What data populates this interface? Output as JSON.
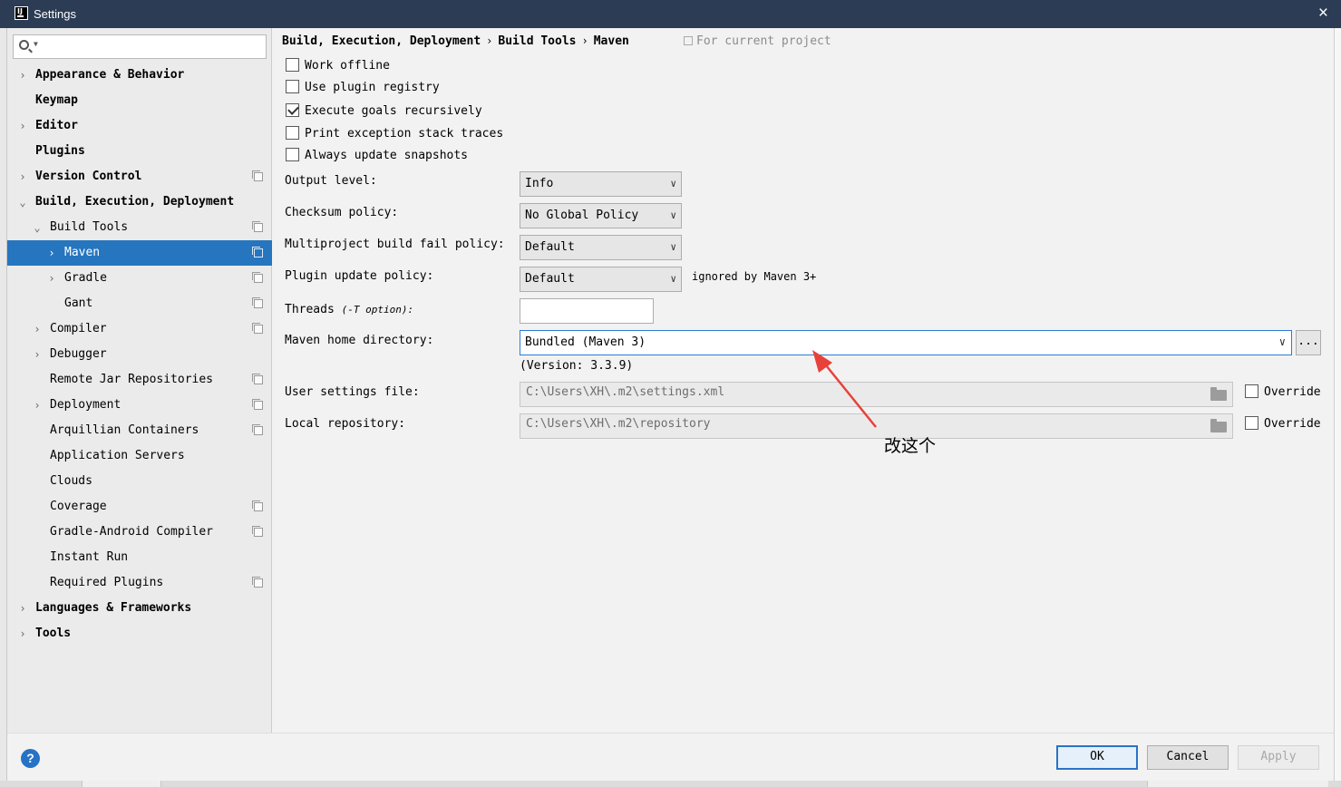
{
  "window": {
    "title": "Settings",
    "close_glyph": "×"
  },
  "sidebar": {
    "search_placeholder": "",
    "items": [
      {
        "label": "Appearance & Behavior",
        "level": 0,
        "arrow": "›",
        "bold": true,
        "proj": false
      },
      {
        "label": "Keymap",
        "level": 0,
        "arrow": "",
        "bold": true,
        "proj": false
      },
      {
        "label": "Editor",
        "level": 0,
        "arrow": "›",
        "bold": true,
        "proj": false
      },
      {
        "label": "Plugins",
        "level": 0,
        "arrow": "",
        "bold": true,
        "proj": false
      },
      {
        "label": "Version Control",
        "level": 0,
        "arrow": "›",
        "bold": true,
        "proj": true
      },
      {
        "label": "Build, Execution, Deployment",
        "level": 0,
        "arrow": "⌄",
        "bold": true,
        "proj": false
      },
      {
        "label": "Build Tools",
        "level": 1,
        "arrow": "⌄",
        "bold": false,
        "proj": true
      },
      {
        "label": "Maven",
        "level": 2,
        "arrow": "›",
        "bold": false,
        "proj": true,
        "selected": true
      },
      {
        "label": "Gradle",
        "level": 2,
        "arrow": "›",
        "bold": false,
        "proj": true
      },
      {
        "label": "Gant",
        "level": 2,
        "arrow": "",
        "bold": false,
        "proj": true
      },
      {
        "label": "Compiler",
        "level": 1,
        "arrow": "›",
        "bold": false,
        "proj": true
      },
      {
        "label": "Debugger",
        "level": 1,
        "arrow": "›",
        "bold": false,
        "proj": false
      },
      {
        "label": "Remote Jar Repositories",
        "level": 1,
        "arrow": "",
        "bold": false,
        "proj": true
      },
      {
        "label": "Deployment",
        "level": 1,
        "arrow": "›",
        "bold": false,
        "proj": true
      },
      {
        "label": "Arquillian Containers",
        "level": 1,
        "arrow": "",
        "bold": false,
        "proj": true
      },
      {
        "label": "Application Servers",
        "level": 1,
        "arrow": "",
        "bold": false,
        "proj": false
      },
      {
        "label": "Clouds",
        "level": 1,
        "arrow": "",
        "bold": false,
        "proj": false
      },
      {
        "label": "Coverage",
        "level": 1,
        "arrow": "",
        "bold": false,
        "proj": true
      },
      {
        "label": "Gradle-Android Compiler",
        "level": 1,
        "arrow": "",
        "bold": false,
        "proj": true
      },
      {
        "label": "Instant Run",
        "level": 1,
        "arrow": "",
        "bold": false,
        "proj": false
      },
      {
        "label": "Required Plugins",
        "level": 1,
        "arrow": "",
        "bold": false,
        "proj": true
      },
      {
        "label": "Languages & Frameworks",
        "level": 0,
        "arrow": "›",
        "bold": true,
        "proj": false
      },
      {
        "label": "Tools",
        "level": 0,
        "arrow": "›",
        "bold": true,
        "proj": false
      }
    ]
  },
  "breadcrumb": {
    "part1": "Build, Execution, Deployment",
    "sep": "›",
    "part2": "Build Tools",
    "part3": "Maven",
    "for_project": "For current project"
  },
  "options": {
    "work_offline": {
      "label": "Work offline",
      "checked": false
    },
    "use_plugin_registry": {
      "label": "Use plugin registry",
      "checked": false
    },
    "execute_goals_recursively": {
      "label": "Execute goals recursively",
      "checked": true
    },
    "print_exception_stack_traces": {
      "label": "Print exception stack traces",
      "checked": false
    },
    "always_update_snapshots": {
      "label": "Always update snapshots",
      "checked": false
    }
  },
  "fields": {
    "output_level": {
      "label": "Output level:",
      "value": "Info"
    },
    "checksum_policy": {
      "label": "Checksum policy:",
      "value": "No Global Policy"
    },
    "multiproject_fail_policy": {
      "label": "Multiproject build fail policy:",
      "value": "Default"
    },
    "plugin_update_policy": {
      "label": "Plugin update policy:",
      "value": "Default",
      "note": "ignored by Maven 3+"
    },
    "threads": {
      "label": "Threads",
      "hint": "(-T option):",
      "value": ""
    },
    "maven_home": {
      "label": "Maven home directory:",
      "value": "Bundled (Maven 3)",
      "browse": "...",
      "version": "(Version: 3.3.9)"
    },
    "user_settings": {
      "label": "User settings file:",
      "value": "C:\\Users\\XH\\.m2\\settings.xml",
      "override": "Override",
      "override_checked": false
    },
    "local_repository": {
      "label": "Local repository:",
      "value": "C:\\Users\\XH\\.m2\\repository",
      "override": "Override",
      "override_checked": false
    }
  },
  "annotation": {
    "text": "改这个",
    "color": "#e8413a"
  },
  "buttons": {
    "help": "?",
    "ok": "OK",
    "cancel": "Cancel",
    "apply": "Apply"
  },
  "colors": {
    "titlebar": "#2b3c54",
    "selection": "#2675bf",
    "accent": "#2a72c8"
  },
  "icons": {
    "search": "search-icon",
    "folder": "folder-icon",
    "project": "project-scope-icon",
    "help": "help-icon"
  }
}
